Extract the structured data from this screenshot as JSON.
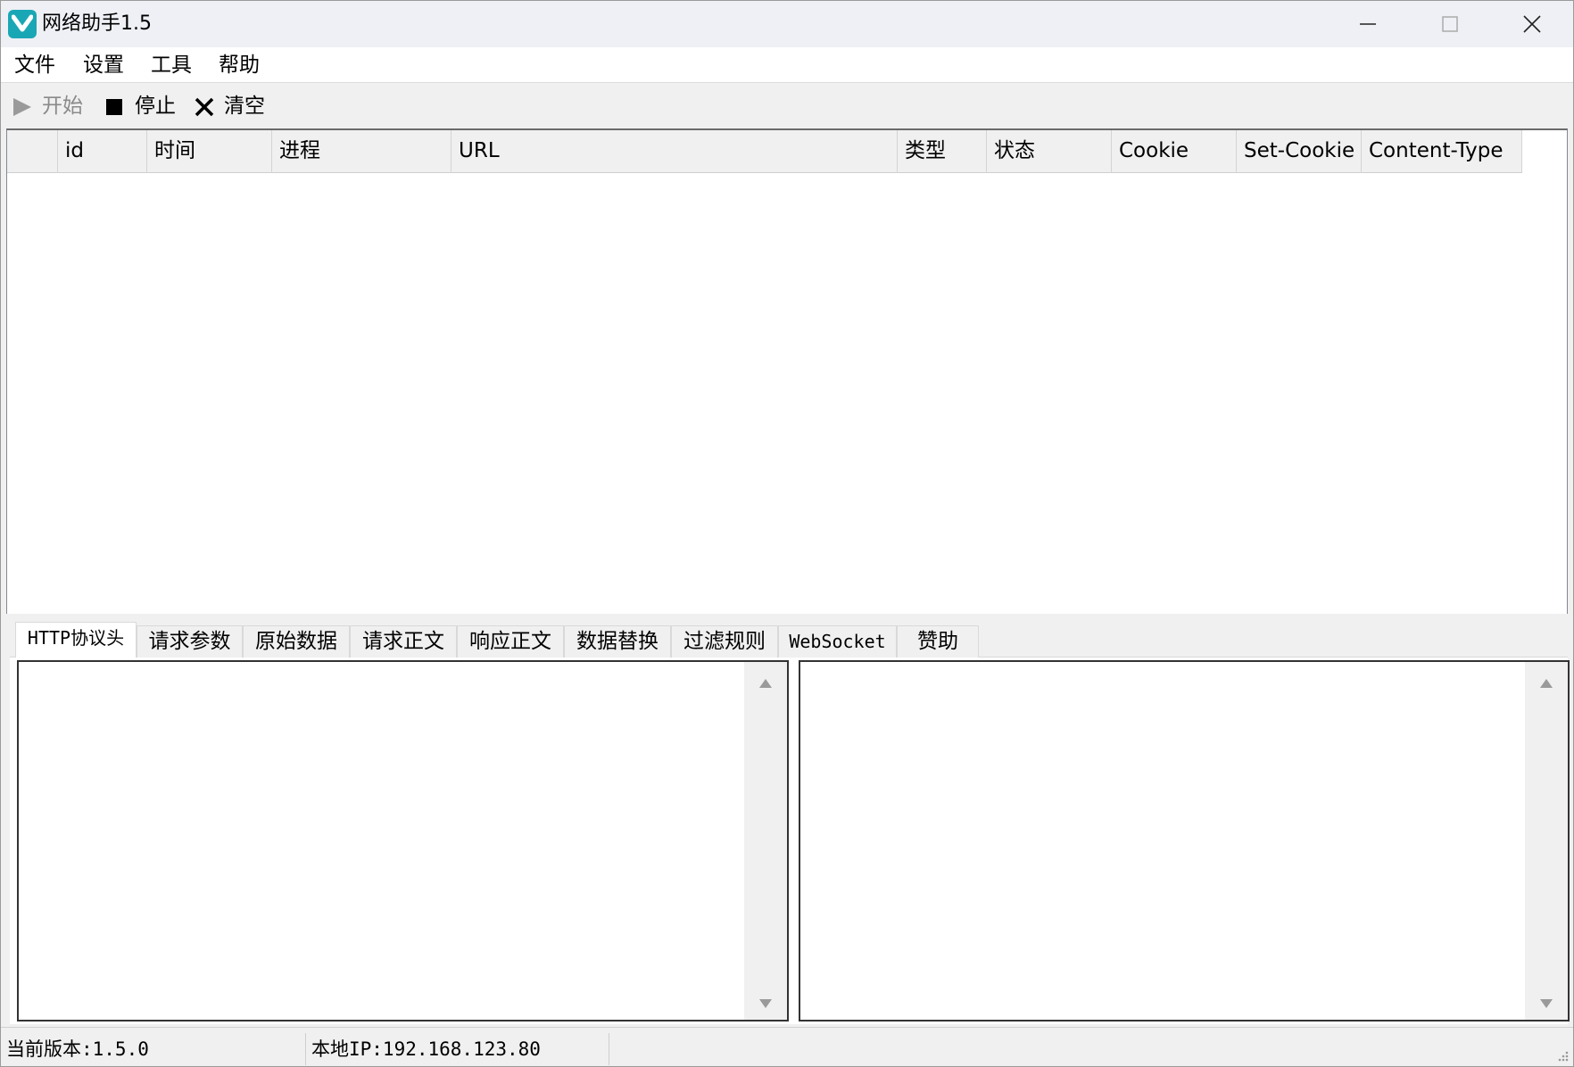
{
  "window": {
    "title": "网络助手1.5"
  },
  "menu": {
    "items": [
      "文件",
      "设置",
      "工具",
      "帮助"
    ]
  },
  "toolbar": {
    "start_label": "开始",
    "stop_label": "停止",
    "clear_label": "清空"
  },
  "list": {
    "columns": [
      "",
      "id",
      "时间",
      "进程",
      "URL",
      "类型",
      "状态",
      "Cookie",
      "Set-Cookie",
      "Content-Type"
    ],
    "rows": []
  },
  "tabs": {
    "items": [
      "HTTP协议头",
      "请求参数",
      "原始数据",
      "请求正文",
      "响应正文",
      "数据替换",
      "过滤规则",
      "WebSocket",
      "赞助"
    ],
    "active": "HTTP协议头"
  },
  "status": {
    "version": "当前版本:1.5.0",
    "ip": "本地IP:192.168.123.80"
  },
  "colors": {
    "accent": "#1aa7b5",
    "window_bg": "#f0f0f0",
    "disabled_text": "#8a8a8a"
  },
  "icons": {
    "app": "app-logo-icon",
    "start": "play-icon",
    "stop": "stop-square-icon",
    "clear": "x-icon"
  }
}
